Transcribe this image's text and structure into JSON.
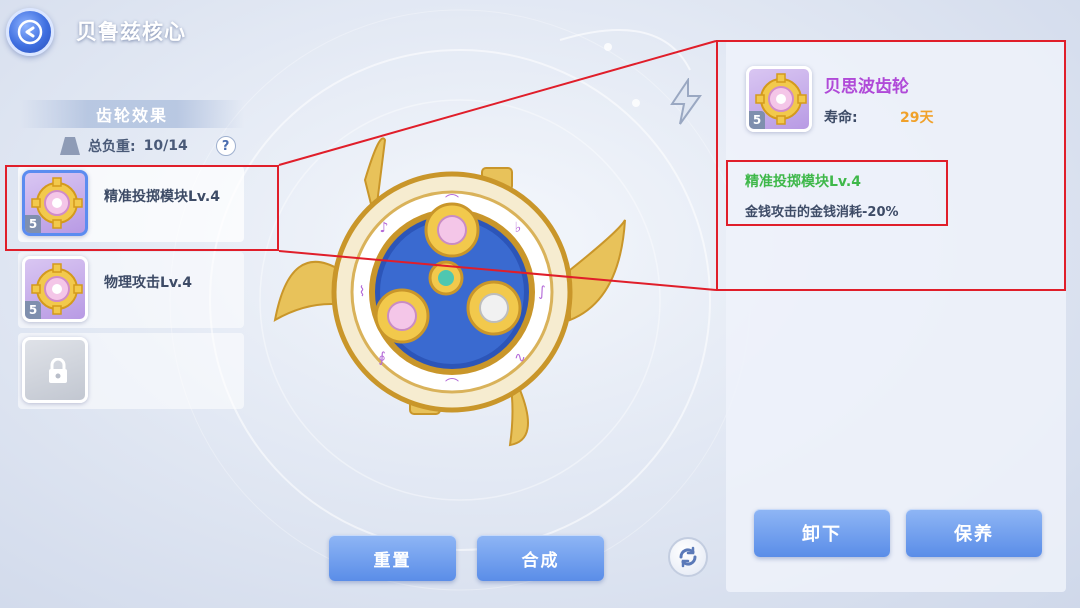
{
  "header": {
    "title": "贝鲁兹核心",
    "back_icon": "back-arrow-icon"
  },
  "left_panel": {
    "section_title": "齿轮效果",
    "load_label": "总负重:",
    "load_value": "10/14",
    "help_symbol": "?",
    "slots": [
      {
        "name": "精准投掷模块Lv.4",
        "level": "5",
        "icon": "gear-icon",
        "selected": true
      },
      {
        "name": "物理攻击Lv.4",
        "level": "5",
        "icon": "gear-icon",
        "selected": false
      },
      {
        "name": "",
        "icon": "lock-icon",
        "locked": true
      }
    ]
  },
  "center": {
    "reset_label": "重置",
    "combine_label": "合成",
    "refresh_icon": "refresh-icon"
  },
  "detail_panel": {
    "item_name": "贝思波齿轮",
    "item_level": "5",
    "life_label": "寿命:",
    "life_value": "29天",
    "effect_name": "精准投掷模块Lv.4",
    "effect_desc": "金钱攻击的金钱消耗-20%",
    "unload_label": "卸下",
    "maintain_label": "保养"
  },
  "colors": {
    "accent_button": "#5a8de8",
    "item_name": "#b04ad8",
    "life_value": "#f0a12a",
    "effect_name": "#3fb84a",
    "highlight_box": "#e01e2a"
  }
}
